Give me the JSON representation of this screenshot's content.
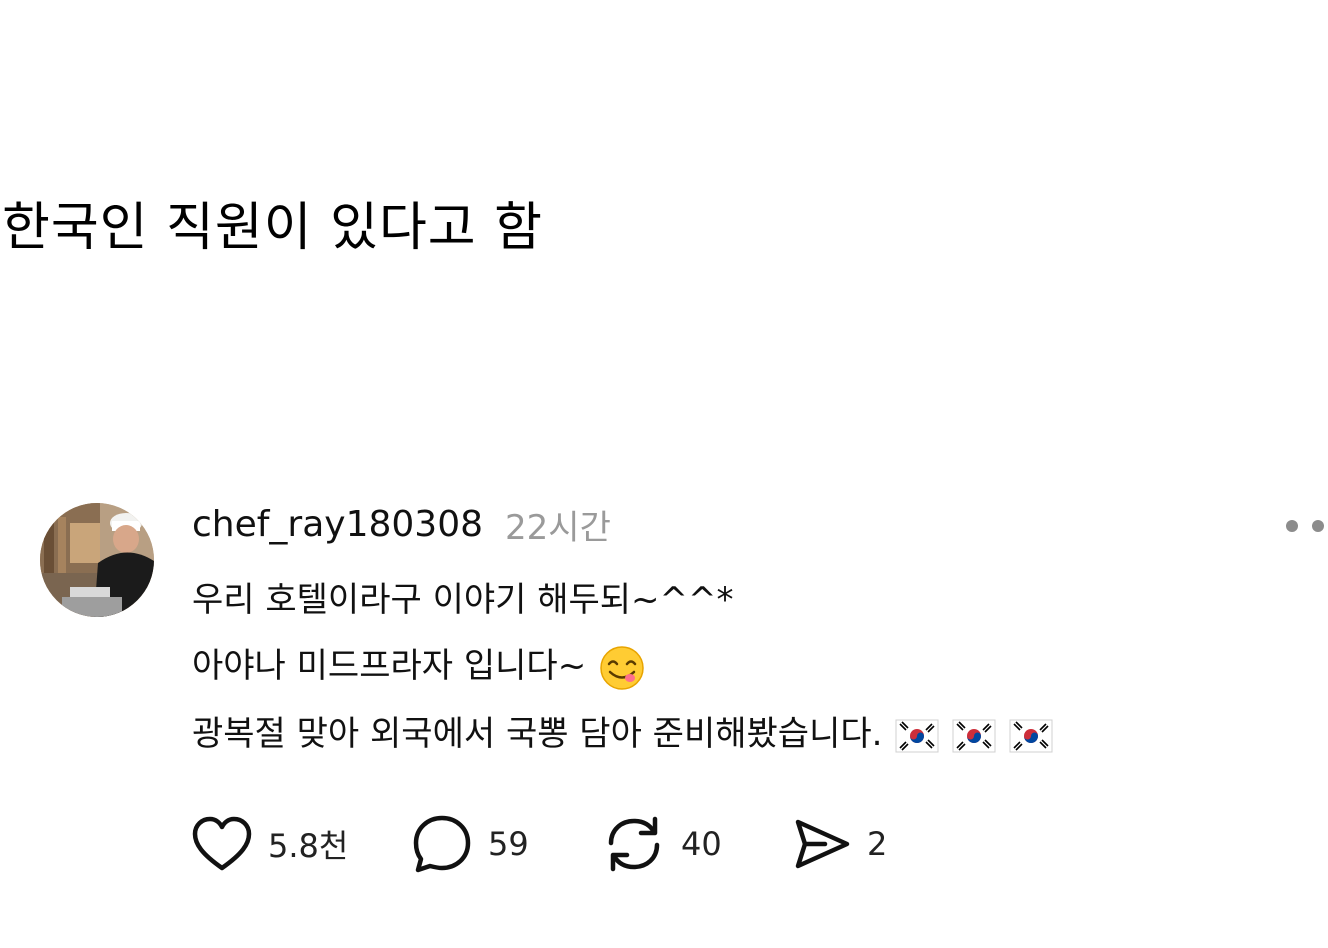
{
  "headline": "한국인 직원이 있다고 함",
  "post": {
    "username": "chef_ray180308",
    "time": "22시간",
    "lines": [
      "우리 호텔이라구 이야기 해두되~^^*",
      "아야나 미드프라자 입니다~",
      "광복절 맞아 외국에서 국뽕 담아 준비해봤습니다."
    ],
    "emoji_line2": "smiling-face-savoring-food-emoji",
    "emoji_line3": [
      "korea-flag-emoji",
      "korea-flag-emoji",
      "korea-flag-emoji"
    ]
  },
  "actions": {
    "likes": "5.8천",
    "comments": "59",
    "reposts": "40",
    "shares": "2"
  },
  "icons": {
    "like": "heart-icon",
    "comment": "speech-bubble-icon",
    "repost": "repost-arrows-icon",
    "share": "paper-plane-icon",
    "more": "more-dots-icon"
  },
  "colors": {
    "text": "#111111",
    "muted": "#9a9a9a",
    "background": "#ffffff"
  }
}
